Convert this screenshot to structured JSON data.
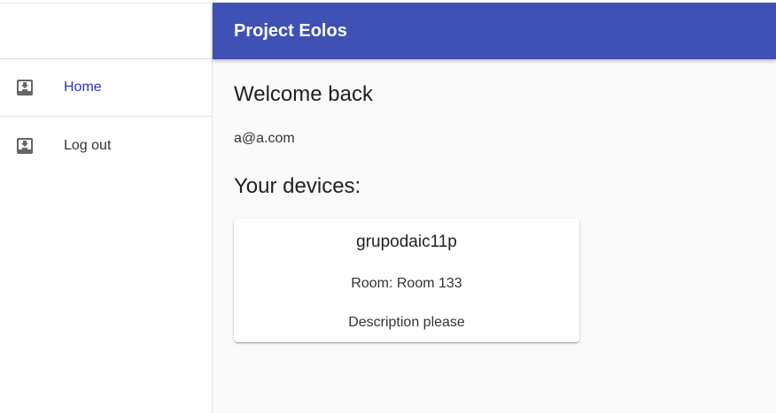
{
  "header": {
    "title": "Project Eolos"
  },
  "sidebar": {
    "items": [
      {
        "label": "Home",
        "icon": "inbox-download-icon",
        "active": true
      },
      {
        "label": "Log out",
        "icon": "inbox-download-icon",
        "active": false
      }
    ]
  },
  "main": {
    "welcome": "Welcome back",
    "email": "a@a.com",
    "devices_title": "Your devices:",
    "devices": [
      {
        "name": "grupodaic11p",
        "room": "Room: Room 133",
        "description": "Description please"
      }
    ]
  },
  "colors": {
    "header_bg": "#3f51b5",
    "active_link": "#2f2fc8",
    "icon": "#666666"
  }
}
